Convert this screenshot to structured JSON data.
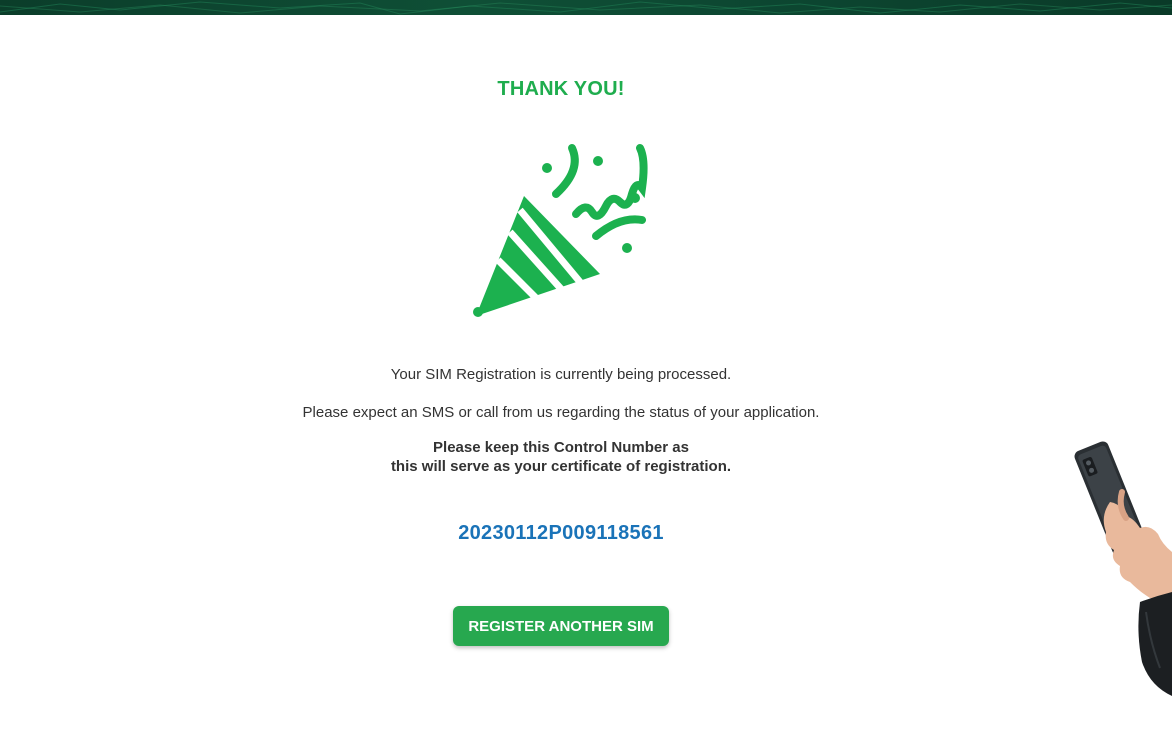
{
  "header": {
    "banner_icon": "decorative-banner"
  },
  "main": {
    "title": "THANK YOU!",
    "illustration_icon": "party-popper-icon",
    "message_line1": "Your SIM Registration is currently being processed.",
    "message_line2": "Please expect an SMS or call from us regarding the status of your application.",
    "keep_notice_line1": "Please keep this Control Number as",
    "keep_notice_line2": "this will serve as your certificate of registration.",
    "control_number": "20230112P009118561",
    "register_button_label": "REGISTER ANOTHER SIM"
  },
  "colors": {
    "brand_green": "#1fad4e",
    "button_green": "#27a84f",
    "control_number_blue": "#1a73b8",
    "banner_dark_green": "#0f4f36"
  }
}
